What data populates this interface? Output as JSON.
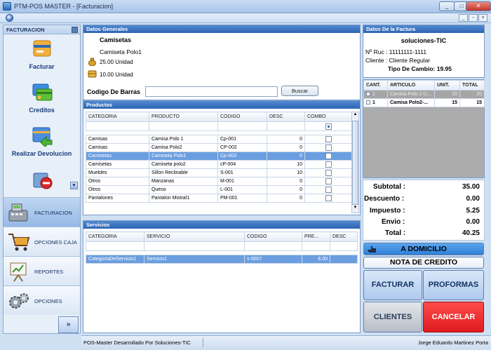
{
  "window": {
    "title": "PTM-POS MASTER - [Facturacion]",
    "min": "_",
    "max": "□",
    "close": "✕",
    "mdi_min": "_",
    "mdi_restore": "▫",
    "mdi_close": "×"
  },
  "sidebar": {
    "header": "FACTURACION",
    "tools": [
      {
        "label": "Facturar",
        "icon": "invoice-card-icon"
      },
      {
        "label": "Creditos",
        "icon": "credit-cards-icon"
      },
      {
        "label": "Realizar Devolucion",
        "icon": "return-icon"
      },
      {
        "label": "",
        "icon": "cancel-icon"
      }
    ],
    "nav": [
      {
        "label": "FACTURACION",
        "icon": "cash-register-icon"
      },
      {
        "label": "OPCIONES CAJA",
        "icon": "shopping-cart-icon"
      },
      {
        "label": "REPORTES",
        "icon": "chart-board-icon"
      },
      {
        "label": "OPCIONES",
        "icon": "gears-icon"
      }
    ],
    "expand": "»"
  },
  "datos_generales": {
    "header": "Datos Generales",
    "categoria": "Camisetas",
    "producto": "Camiseta Polo1",
    "existencia": "25.00 Unidad",
    "precio": "10.00 Unidad",
    "barcode_label": "Codigo De Barras",
    "barcode_value": "",
    "buscar": "Buscar"
  },
  "productos": {
    "header": "Productos",
    "columns": [
      "CATEGORIA",
      "PRODUCTO",
      "CODIGO",
      "DESC",
      "COMBO"
    ],
    "rows": [
      {
        "categoria": "Camisas",
        "producto": "Camisa Polo 1",
        "codigo": "Cp-001",
        "desc": "0"
      },
      {
        "categoria": "Camisas",
        "producto": "Camisa Polo2",
        "codigo": "CP-002",
        "desc": "0"
      },
      {
        "categoria": "Camisetas",
        "producto": "Camiseta Polo1",
        "codigo": "Cp-003",
        "desc": "0"
      },
      {
        "categoria": "Camisetas",
        "producto": "Camiseta polo2",
        "codigo": "cP-004",
        "desc": "10"
      },
      {
        "categoria": "Muebles",
        "producto": "Sillon Reclinable",
        "codigo": "S-001",
        "desc": "10"
      },
      {
        "categoria": "Otros",
        "producto": "Manzanas",
        "codigo": "M-001",
        "desc": "0"
      },
      {
        "categoria": "Otros",
        "producto": "Queso",
        "codigo": "L-001",
        "desc": "0"
      },
      {
        "categoria": "Pantalones",
        "producto": "Pantalon Mistral1",
        "codigo": "PM-001",
        "desc": "0"
      }
    ],
    "selected_index": 2
  },
  "servicios": {
    "header": "Servicios",
    "columns": [
      "CATEGORIA",
      "SERVICIO",
      "CODIGO",
      "PRE...",
      "DESC"
    ],
    "rows": [
      {
        "categoria": "CategoriaDeServicio1",
        "servicio": "Servicio1",
        "codigo": "s-0007",
        "precio": "6.00",
        "desc": ""
      }
    ]
  },
  "factura": {
    "header": "Datos De la Factura",
    "empresa": "soluciones-TIC",
    "ruc": "Nº Ruc : 11111111-1111",
    "cliente": "Cliente : Cliente Regular",
    "tipo_cambio": "Tipo De Cambio: 19.95",
    "columns": [
      "CANT.",
      "ARTICULO",
      "UNIT.",
      "TOTAL"
    ],
    "items": [
      {
        "cant": "1",
        "articulo": "Camisa Polo 1-U...",
        "unit": "20",
        "total": "20"
      },
      {
        "cant": "1",
        "articulo": "Camisa Polo2-...",
        "unit": "15",
        "total": "15"
      }
    ],
    "totals": [
      {
        "label": "Subtotal :",
        "value": "35.00"
      },
      {
        "label": "Descuento :",
        "value": "0.00"
      },
      {
        "label": "Impuesto :",
        "value": "5.25"
      },
      {
        "label": "Envio :",
        "value": "0.00"
      },
      {
        "label": "Total :",
        "value": "40.25"
      }
    ],
    "domicilio": "A DOMICILIO",
    "nota_credito": "NOTA DE CREDITO",
    "facturar": "FACTURAR",
    "proformas": "PROFORMAS",
    "clientes": "CLIENTES",
    "cancelar": "CANCELAR"
  },
  "status": {
    "left": "POS-Master Desarrollado Por Soluciones-TIC",
    "right": "Jorge Eduardo  Martinez Porta"
  },
  "colors": {
    "accent": "#2c64b3",
    "selected": "#6a9ee0",
    "cancel": "#e8222a",
    "domicilio": "#3d8de0"
  }
}
